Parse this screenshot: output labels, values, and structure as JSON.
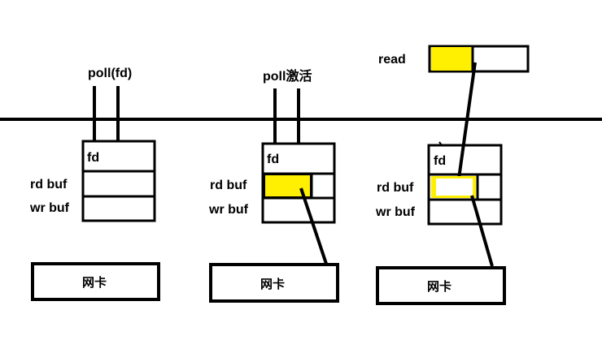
{
  "colors": {
    "ink": "#000000",
    "highlight": "#ffef00",
    "background": "#ffffff"
  },
  "labels": {
    "poll_fd": "poll(fd)",
    "poll_activate": "poll激活",
    "read": "read"
  },
  "panels": [
    {
      "fd": "fd",
      "rd_buf": "rd buf",
      "wr_buf": "wr buf",
      "nic": "网卡"
    },
    {
      "fd": "fd",
      "rd_buf": "rd buf",
      "wr_buf": "wr buf",
      "nic": "网卡"
    },
    {
      "fd": "fd",
      "rd_buf": "rd buf",
      "wr_buf": "wr buf",
      "nic": "网卡"
    }
  ]
}
